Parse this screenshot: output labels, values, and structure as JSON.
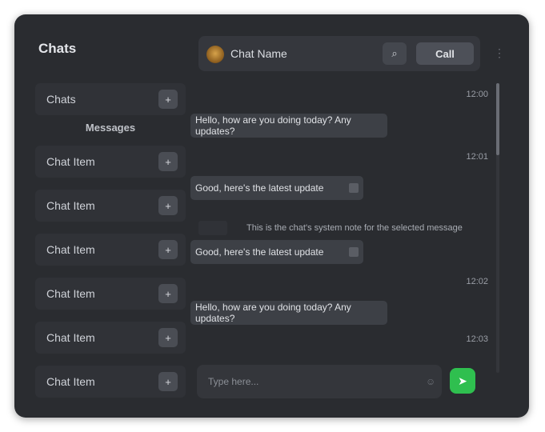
{
  "sidebar": {
    "title": "Chats",
    "top_item": {
      "label": "Chats",
      "button": "+"
    },
    "section_label": "Messages",
    "items": [
      {
        "label": "Chat Item",
        "button": "+"
      },
      {
        "label": "Chat Item",
        "button": "+"
      },
      {
        "label": "Chat Item",
        "button": "+"
      },
      {
        "label": "Chat Item",
        "button": "+"
      },
      {
        "label": "Chat Item",
        "button": "+"
      },
      {
        "label": "Chat Item",
        "button": "+"
      }
    ]
  },
  "header": {
    "contact_name": "Chat Name",
    "icon_button": "⌕",
    "action_button": "Call",
    "menu_icon": "⋮"
  },
  "messages": [
    {
      "time": "12:00",
      "text": "Hello, how are you doing today? Any updates?"
    },
    {
      "time": "12:01",
      "text": "Good, here's the latest update"
    },
    {
      "time": "",
      "system": "This is the chat's system note for the selected message"
    },
    {
      "time": "",
      "text": "Good, here's the latest update"
    },
    {
      "time": "12:02",
      "text": "Hello, how are you doing today? Any updates?"
    },
    {
      "time": "12:03",
      "text": ""
    }
  ],
  "composer": {
    "placeholder": "Type here...",
    "emoji_icon": "☺",
    "send_icon": "➤"
  },
  "colors": {
    "background": "#2a2c30",
    "accent_send": "#2fbf4f"
  }
}
